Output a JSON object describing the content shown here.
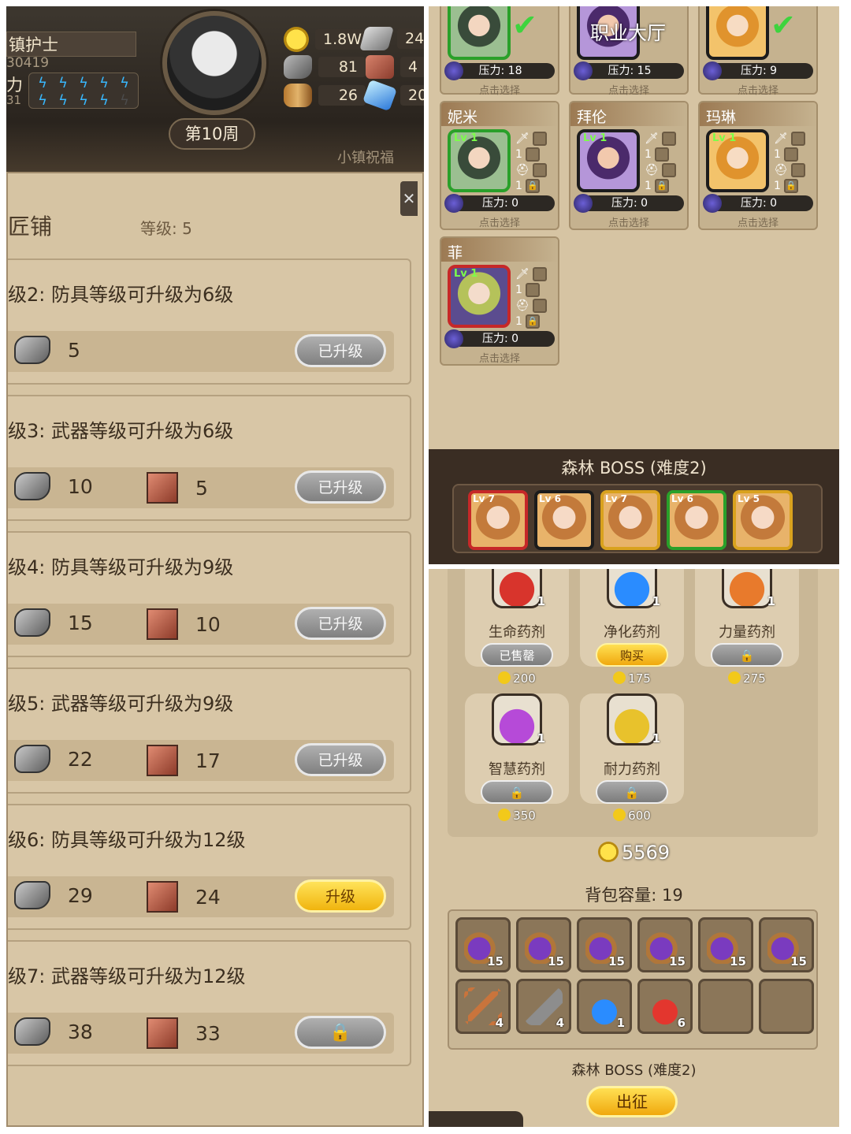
{
  "left": {
    "hud": {
      "title": "镇护士",
      "id_text": "30419",
      "power_label": "力",
      "sub_text": "31",
      "week": "第10周",
      "banner": "小镇祝福",
      "resources": [
        {
          "icon": "gold-coin-icon",
          "value": "1.8W"
        },
        {
          "icon": "iron-ingot-icon",
          "value": "24"
        },
        {
          "icon": "stone-icon",
          "value": "81"
        },
        {
          "icon": "leather-icon",
          "value": "4"
        },
        {
          "icon": "wood-log-icon",
          "value": "26"
        },
        {
          "icon": "crystal-icon",
          "value": "20"
        }
      ],
      "energy": {
        "filled": 9,
        "total": 10
      }
    },
    "shop": {
      "title": "匠铺",
      "level_label": "等级: 5",
      "upgrades": [
        {
          "title": "级2: 防具等级可升级为6级",
          "stone": "5",
          "leather": "",
          "button": "已升级",
          "state": "done"
        },
        {
          "title": "级3: 武器等级可升级为6级",
          "stone": "10",
          "leather": "5",
          "button": "已升级",
          "state": "done"
        },
        {
          "title": "级4: 防具等级可升级为9级",
          "stone": "15",
          "leather": "10",
          "button": "已升级",
          "state": "done"
        },
        {
          "title": "级5: 武器等级可升级为9级",
          "stone": "22",
          "leather": "17",
          "button": "已升级",
          "state": "done"
        },
        {
          "title": "级6: 防具等级可升级为12级",
          "stone": "29",
          "leather": "24",
          "button": "升级",
          "state": "go"
        },
        {
          "title": "级7: 武器等级可升级为12级",
          "stone": "38",
          "leather": "33",
          "button": "🔒",
          "state": "lock"
        }
      ]
    }
  },
  "right_top": {
    "career_hall": "职业大厅",
    "top_cards": [
      {
        "stress": "压力: 18",
        "pick": "点击选择"
      },
      {
        "stress": "压力: 15",
        "pick": "点击选择"
      },
      {
        "stress": "压力: 9",
        "pick": "点击选择"
      }
    ],
    "heroes": [
      {
        "name": "妮米",
        "lv": "Lv 1",
        "weapon": "1",
        "armor": "1",
        "extra": "1",
        "stress": "压力: 0",
        "pick": "点击选择",
        "frame": "green"
      },
      {
        "name": "拜伦",
        "lv": "Lv 1",
        "weapon": "1",
        "armor": "1",
        "extra": "1",
        "stress": "压力: 0",
        "pick": "点击选择",
        "frame": "dark"
      },
      {
        "name": "玛琳",
        "lv": "Lv 1",
        "weapon": "1",
        "armor": "1",
        "extra": "1",
        "stress": "压力: 0",
        "pick": "点击选择",
        "frame": "gold"
      },
      {
        "name": "菲",
        "lv": "Lv 1",
        "weapon": "1",
        "armor": "1",
        "extra": "1",
        "stress": "压力: 0",
        "pick": "点击选择",
        "frame": "red"
      }
    ],
    "boss_title": "森林 BOSS (难度2)",
    "team": [
      {
        "lv": "Lv 7",
        "color": "#c62828"
      },
      {
        "lv": "Lv 6",
        "color": "#1c1c1c"
      },
      {
        "lv": "Lv 7",
        "color": "#d9a21e"
      },
      {
        "lv": "Lv 6",
        "color": "#2aa02a"
      },
      {
        "lv": "Lv 5",
        "color": "#d9a21e"
      }
    ]
  },
  "right_bottom": {
    "potions": [
      {
        "name": "生命药剂",
        "count": "1",
        "button": "已售罄",
        "state": "sold",
        "price": "200",
        "color": "#d8342c"
      },
      {
        "name": "净化药剂",
        "count": "1",
        "button": "购买",
        "state": "buy",
        "price": "175",
        "color": "#2a8cff"
      },
      {
        "name": "力量药剂",
        "count": "1",
        "button": "🔒",
        "state": "lock",
        "price": "275",
        "color": "#e87a2c"
      },
      {
        "name": "智慧药剂",
        "count": "1",
        "button": "🔒",
        "state": "lock",
        "price": "350",
        "color": "#b64ad8"
      },
      {
        "name": "耐力药剂",
        "count": "1",
        "button": "🔒",
        "state": "lock",
        "price": "600",
        "color": "#e8c22c"
      }
    ],
    "gold_total": "5569",
    "bag_capacity": "背包容量: 19",
    "bag_items": [
      {
        "icon": "grape-food-icon",
        "count": "15"
      },
      {
        "icon": "grape-food-icon",
        "count": "15"
      },
      {
        "icon": "grape-food-icon",
        "count": "15"
      },
      {
        "icon": "grape-food-icon",
        "count": "15"
      },
      {
        "icon": "grape-food-icon",
        "count": "15"
      },
      {
        "icon": "grape-food-icon",
        "count": "15"
      },
      {
        "icon": "key-icon",
        "count": "4"
      },
      {
        "icon": "shovel-icon",
        "count": "4"
      },
      {
        "icon": "blue-potion-icon",
        "count": "1"
      },
      {
        "icon": "red-potion-icon",
        "count": "6"
      },
      {
        "icon": "",
        "count": ""
      },
      {
        "icon": "",
        "count": ""
      }
    ],
    "boss_label": "森林 BOSS (难度2)",
    "expedition_button": "出征"
  }
}
